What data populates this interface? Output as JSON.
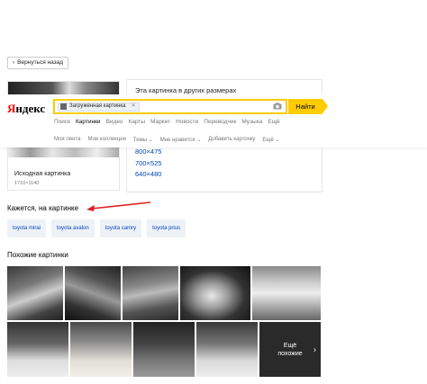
{
  "back_button": {
    "label": "Вернуться назад"
  },
  "logo": {
    "first_letter": "Я",
    "rest": "ндекс"
  },
  "search": {
    "chip_label": "Загруженная картинка",
    "button_label": "Найти"
  },
  "tabs": [
    "Поиск",
    "Картинки",
    "Видео",
    "Карты",
    "Маркет",
    "Новости",
    "Переводчик",
    "Музыка",
    "Ещё"
  ],
  "active_tab": "Картинки",
  "subtabs": [
    "Моя лента",
    "Мои коллекции",
    "Темы",
    "Мне нравится",
    "Добавить карточку",
    "Ещё"
  ],
  "original": {
    "title": "Исходная картинка",
    "size": "1710×1140"
  },
  "other_sizes": {
    "title": "Эта картинка в других размерах",
    "sizes": [
      "800×475",
      "700×525",
      "640×480"
    ]
  },
  "detected": {
    "title": "Кажется, на картинке",
    "tags": [
      "toyota mirai",
      "toyota avalon",
      "toyota camry",
      "toyota prius"
    ]
  },
  "similar": {
    "title": "Похожие картинки",
    "more_label_1": "Ещё",
    "more_label_2": "похожие"
  },
  "colors": {
    "accent_yellow": "#ffcc00",
    "link_blue": "#0044bb",
    "logo_red": "#ff0000",
    "annotation_red": "#e02020"
  }
}
